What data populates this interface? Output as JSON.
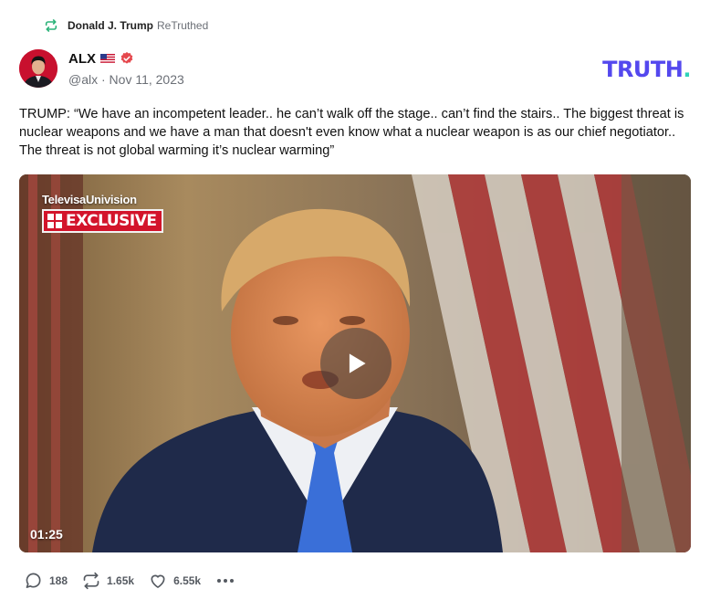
{
  "retruth": {
    "icon": "retruth-icon",
    "user": "Donald J. Trump",
    "label": "ReTruthed",
    "color": "#2db37a"
  },
  "author": {
    "name": "ALX",
    "flag_icon": "us-flag-icon",
    "verified_icon": "verified-badge-icon",
    "handle_date": "@alx · Nov 11, 2023"
  },
  "brand": {
    "logo": "TRUTH",
    "dot": ".",
    "color": "#5448ee",
    "dot_color": "#2fd3b8"
  },
  "post": {
    "text": "TRUMP: “We have an incompetent leader.. he can’t walk off the stage.. can’t find the stairs.. The biggest threat is nuclear weapons and we have a man that doesn't even know what a nuclear weapon is as our chief negotiator.. The threat is not global warming it’s nuclear warming”"
  },
  "video": {
    "watermark_network": "TelevisaUnivision",
    "watermark_badge": "EXCLUSIVE",
    "duration": "01:25",
    "play_icon": "play-icon"
  },
  "actions": {
    "replies": "188",
    "retruths": "1.65k",
    "likes": "6.55k",
    "reply_icon": "reply-bubble-icon",
    "retruth_icon": "retruth-icon",
    "like_icon": "heart-icon",
    "more_icon": "more-dots-icon"
  }
}
